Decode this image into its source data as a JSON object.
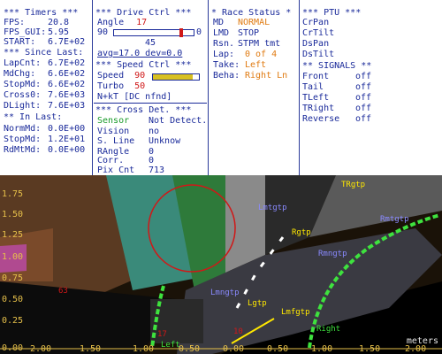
{
  "timers": {
    "title": "*** Timers ***",
    "rows": [
      {
        "label": "FPS:",
        "value": "20.8"
      },
      {
        "label": "FPS_GUI:",
        "value": "5.95"
      },
      {
        "label": "START:",
        "value": "6.7E+02"
      }
    ],
    "since_title": "*** Since Last:",
    "since_rows": [
      {
        "label": "LapCnt:",
        "value": "6.7E+02"
      },
      {
        "label": "MdChg:",
        "value": "6.6E+02"
      },
      {
        "label": "StopMd:",
        "value": "6.6E+02"
      },
      {
        "label": "Cross0:",
        "value": "7.6E+03"
      },
      {
        "label": "DLight:",
        "value": "7.6E+03"
      }
    ],
    "in_title": "** In Last:",
    "in_rows": [
      {
        "label": "NormMd:",
        "value": "0.0E+00"
      },
      {
        "label": "StopMd:",
        "value": "1.2E+01"
      },
      {
        "label": "RdMtMd:",
        "value": "0.0E+00"
      }
    ]
  },
  "drive": {
    "title": "***  Drive Ctrl  ***",
    "angle_label": "Angle",
    "angle_value": "17",
    "range_min": "90",
    "range_max": "0",
    "center_value": "45",
    "avg_text": "avg=17.0  dev=0.0",
    "speed_title": "***  Speed Ctrl  ***",
    "speed_label": "Speed",
    "speed_value": "90",
    "turbo_label": "Turbo",
    "turbo_value": "50",
    "nkt_text": "N+kT [DC nfnd]",
    "speed_fill": 0.86
  },
  "cross": {
    "title": "*** Cross Det. ***",
    "rows": [
      {
        "label": "Sensor",
        "value": "Not Detect."
      },
      {
        "label": "Vision",
        "value": "no"
      },
      {
        "label": "S. Line",
        "value": "Unknow"
      },
      {
        "label": "RAngle",
        "value": "0"
      },
      {
        "label": "Corr.",
        "value": "0"
      },
      {
        "label": "Pix Cnt",
        "value": "713"
      }
    ]
  },
  "race": {
    "title": "* Race Status *",
    "rows": [
      {
        "label": "MD",
        "value": "NORMAL"
      },
      {
        "label": "LMD",
        "value": "STOP"
      },
      {
        "label": "Rsn.",
        "value": "STPM tmt"
      },
      {
        "label": "Lap:",
        "value": "0 of 4"
      },
      {
        "label": "Take:",
        "value": "Left"
      },
      {
        "label": "Beha:",
        "value": "Right Ln"
      }
    ]
  },
  "ptu": {
    "title": "*** PTU ***",
    "items": [
      "CrPan",
      "CrTilt",
      "DsPan",
      "DsTilt"
    ]
  },
  "signals": {
    "title": "** SIGNALS **",
    "rows": [
      {
        "label": "Front",
        "value": "off"
      },
      {
        "label": "Tail",
        "value": "off"
      },
      {
        "label": "TLeft",
        "value": "off"
      },
      {
        "label": "TRight",
        "value": "off"
      },
      {
        "label": "Reverse",
        "value": "off"
      }
    ]
  },
  "view": {
    "y_ticks": [
      "1.75",
      "1.50",
      "1.25",
      "1.00",
      "0.75",
      "0.50",
      "0.25",
      "0.00"
    ],
    "x_ticks": [
      "2.00",
      "1.50",
      "1.00",
      "0.50",
      "0.00",
      "-0.50",
      "-1.00",
      "-1.50",
      "-2.00"
    ],
    "unit": "meters",
    "labels": {
      "rgtp_top": "TRgtp",
      "rgtp": "Rgtp",
      "lmtgtp": "Lmtgtp",
      "lmngtp": "Lmngtp",
      "lgtp": "Lgtp",
      "lmfgtp": "Lmfgtp",
      "rmngtp": "Rmngtp",
      "rmtgtp": "Rmtgtp",
      "left": "Left",
      "right": "Right",
      "num_left": "17",
      "num_mid": "10",
      "num_red": "63"
    },
    "colors": {
      "lane_green": "#3ee23e",
      "marker_yellow": "#ffe800",
      "marker_blue": "#3a3aff",
      "circle_red": "#d01818"
    }
  }
}
